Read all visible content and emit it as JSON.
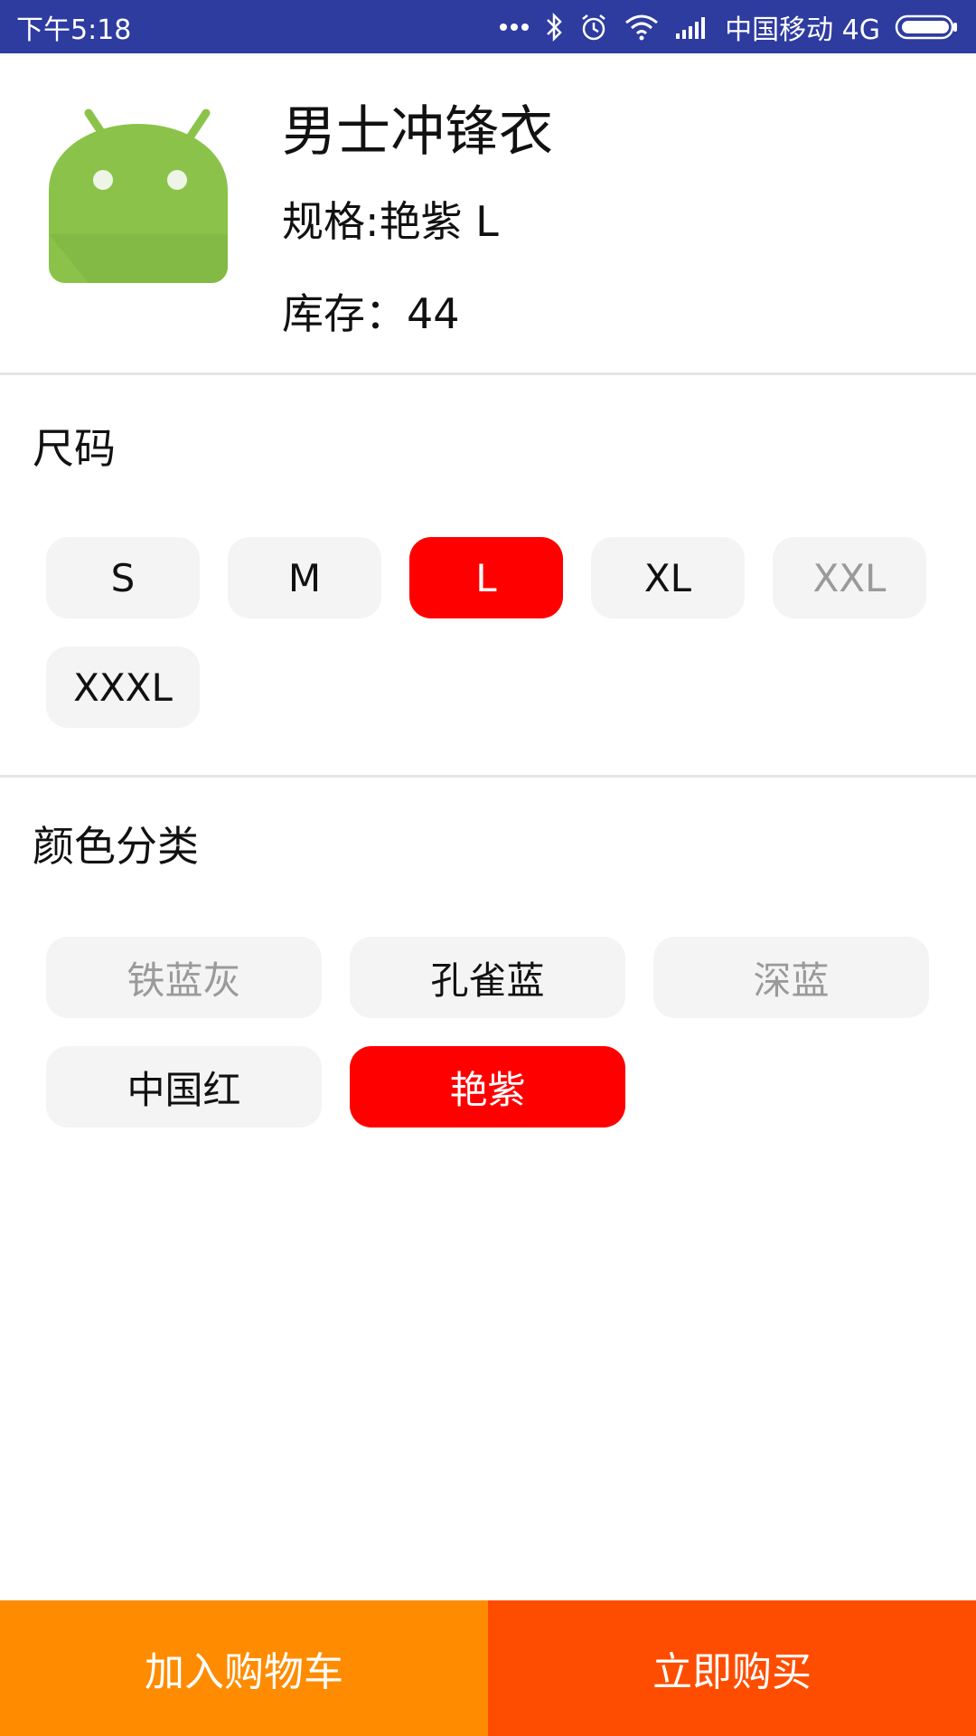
{
  "status_bar": {
    "time": "下午5:18",
    "carrier": "中国移动 4G",
    "icons": [
      "more-dots-icon",
      "bluetooth-icon",
      "alarm-icon",
      "wifi-icon",
      "signal-icon",
      "battery-icon"
    ]
  },
  "product": {
    "title": "男士冲锋衣",
    "spec": "规格:艳紫 L",
    "stock": "库存：44",
    "image_icon": "android-robot-icon"
  },
  "size": {
    "title": "尺码",
    "options": [
      {
        "label": "S",
        "state": "normal"
      },
      {
        "label": "M",
        "state": "normal"
      },
      {
        "label": "L",
        "state": "selected"
      },
      {
        "label": "XL",
        "state": "normal"
      },
      {
        "label": "XXL",
        "state": "disabled"
      },
      {
        "label": "XXXL",
        "state": "normal"
      }
    ]
  },
  "color": {
    "title": "颜色分类",
    "options": [
      {
        "label": "铁蓝灰",
        "state": "disabled"
      },
      {
        "label": "孔雀蓝",
        "state": "normal"
      },
      {
        "label": "深蓝",
        "state": "disabled"
      },
      {
        "label": "中国红",
        "state": "normal"
      },
      {
        "label": "艳紫",
        "state": "selected"
      }
    ]
  },
  "actions": {
    "add_to_cart": "加入购物车",
    "buy_now": "立即购买"
  },
  "colors": {
    "status_bar": "#2e3b9f",
    "selected": "#ff0000",
    "chip_bg": "#f4f4f4",
    "disabled_text": "#9a9a9a",
    "cart_button": "#ff8c00",
    "buy_button": "#ff4d00"
  }
}
